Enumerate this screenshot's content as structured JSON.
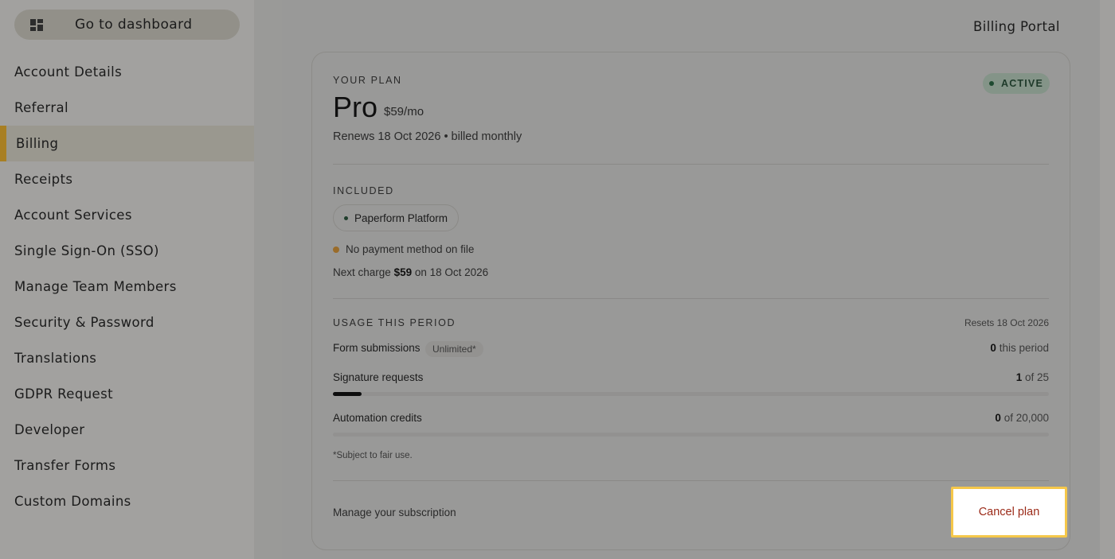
{
  "sidebar": {
    "dashboard_label": "Go to dashboard",
    "items": [
      {
        "label": "Account Details",
        "active": false
      },
      {
        "label": "Referral",
        "active": false
      },
      {
        "label": "Billing",
        "active": true
      },
      {
        "label": "Receipts",
        "active": false
      },
      {
        "label": "Account Services",
        "active": false
      },
      {
        "label": "Single Sign-On (SSO)",
        "active": false
      },
      {
        "label": "Manage Team Members",
        "active": false
      },
      {
        "label": "Security & Password",
        "active": false
      },
      {
        "label": "Translations",
        "active": false
      },
      {
        "label": "GDPR Request",
        "active": false
      },
      {
        "label": "Developer",
        "active": false
      },
      {
        "label": "Transfer Forms",
        "active": false
      },
      {
        "label": "Custom Domains",
        "active": false
      }
    ]
  },
  "header": {
    "title": "Billing Portal"
  },
  "plan": {
    "section_label": "YOUR PLAN",
    "name": "Pro",
    "price": "$59/mo",
    "renews": "Renews 18 Oct 2026 • billed monthly",
    "status": "ACTIVE",
    "status_color": "#1e4a30"
  },
  "included": {
    "section_label": "INCLUDED",
    "items": [
      "Paperform Platform"
    ],
    "payment_warning": "No payment method on file",
    "next_charge_prefix": "Next charge",
    "next_charge_amount": "$59",
    "next_charge_suffix": "on 18 Oct 2026"
  },
  "usage": {
    "section_label": "USAGE THIS PERIOD",
    "resets": "Resets 18 Oct 2026",
    "rows": [
      {
        "name": "Form submissions",
        "tag": "Unlimited*",
        "value": "0",
        "suffix": "this period"
      },
      {
        "name": "Signature requests",
        "value": "1",
        "suffix": "of 25",
        "progress": 0.04
      },
      {
        "name": "Automation credits",
        "value": "0",
        "suffix": "of 20,000",
        "progress": 0
      }
    ],
    "footnote": "*Subject to fair use."
  },
  "footer": {
    "manage_label": "Manage your subscription",
    "cancel_label": "Cancel plan"
  }
}
